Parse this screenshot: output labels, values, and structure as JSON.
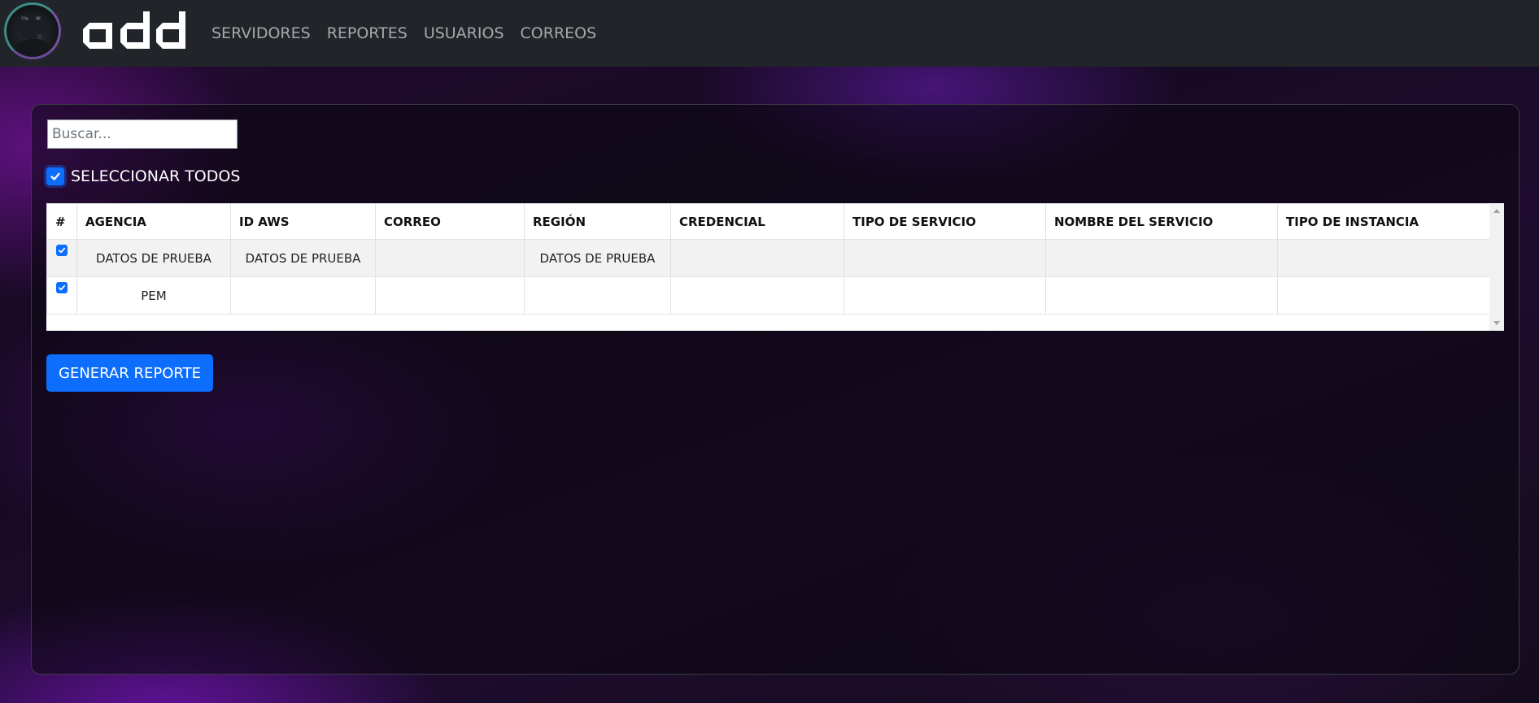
{
  "navbar": {
    "avatar_icon": "avatar-image",
    "logo_text": "odd",
    "links": [
      {
        "label": "SERVIDORES"
      },
      {
        "label": "REPORTES"
      },
      {
        "label": "USUARIOS"
      },
      {
        "label": "CORREOS"
      }
    ]
  },
  "search": {
    "placeholder": "Buscar...",
    "value": ""
  },
  "select_all": {
    "label": "SELECCIONAR TODOS",
    "checked": true
  },
  "table": {
    "columns": [
      "#",
      "AGENCIA",
      "ID AWS",
      "CORREO",
      "REGIÓN",
      "CREDENCIAL",
      "TIPO DE SERVICIO",
      "NOMBRE DEL SERVICIO",
      "TIPO DE INSTANCIA"
    ],
    "rows": [
      {
        "checked": true,
        "agencia": "DATOS DE PRUEBA",
        "id_aws": "DATOS DE PRUEBA",
        "correo": "",
        "region": "DATOS DE PRUEBA",
        "credencial": "",
        "tipo_servicio": "",
        "nombre_servicio": "",
        "tipo_instancia": ""
      },
      {
        "checked": true,
        "agencia": "PEM",
        "id_aws": "",
        "correo": "",
        "region": "",
        "credencial": "",
        "tipo_servicio": "",
        "nombre_servicio": "",
        "tipo_instancia": ""
      }
    ]
  },
  "actions": {
    "generate_label": "GENERAR REPORTE"
  },
  "colors": {
    "navbar_bg": "#212529",
    "primary": "#0d6efd",
    "nav_link": "#a5a8ab"
  }
}
